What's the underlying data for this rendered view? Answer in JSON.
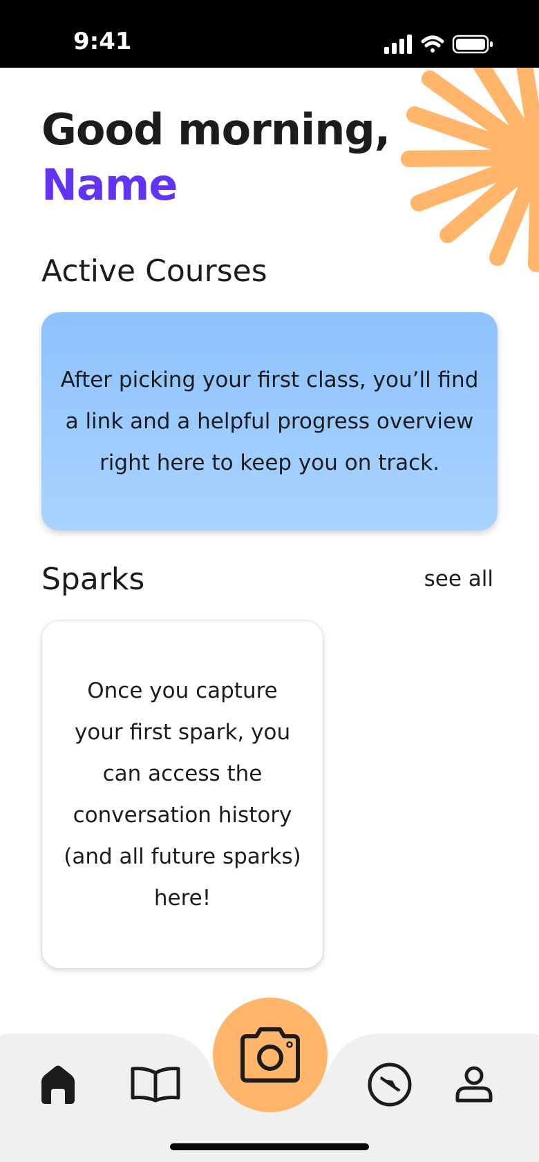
{
  "status_bar": {
    "time": "9:41"
  },
  "greeting": {
    "line1": "Good morning,",
    "name": "Name"
  },
  "active_courses": {
    "title": "Active Courses",
    "empty_message": "After picking your first class, you’ll find a link and a helpful progress overview right here to keep you on track."
  },
  "sparks": {
    "title": "Sparks",
    "see_all_label": "see all",
    "empty_message": "Once you capture your first spark, you can access the conversation history (and all future sparks) here!"
  },
  "nav": {
    "items": [
      {
        "icon": "home-icon",
        "active": true
      },
      {
        "icon": "book-icon",
        "active": false
      },
      {
        "icon": "camera-icon",
        "active": false
      },
      {
        "icon": "compass-icon",
        "active": false
      },
      {
        "icon": "profile-icon",
        "active": false
      }
    ]
  },
  "colors": {
    "accent_purple": "#6233f5",
    "accent_orange": "#ffb66a",
    "card_blue_top": "#8dc2fd",
    "card_blue_bottom": "#a9d3fe",
    "nav_background": "#f0f0f0"
  }
}
